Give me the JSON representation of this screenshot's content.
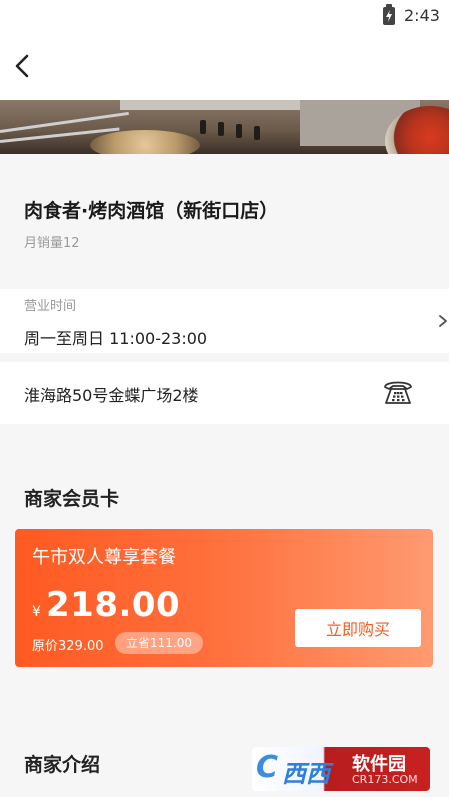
{
  "status_bar": {
    "time": "2:43"
  },
  "shop": {
    "name": "肉食者·烤肉酒馆（新街口店）",
    "monthly_sales": "月销量12"
  },
  "hours": {
    "label": "营业时间",
    "value": "周一至周日 11:00-23:00"
  },
  "address": {
    "text": "淮海路50号金蝶广场2楼"
  },
  "membership": {
    "section_title": "商家会员卡",
    "package_name": "午市双人尊享套餐",
    "currency": "¥",
    "price": "218.00",
    "original_price": "原价329.00",
    "save_badge": "立省111.00",
    "buy_label": "立即购买"
  },
  "intro": {
    "section_title": "商家介绍"
  },
  "watermark": {
    "main": "软件园",
    "sub": "CR173.COM",
    "logo": "西西"
  },
  "colors": {
    "accent": "#ff5a22",
    "card_gradient_end": "#ff9a70",
    "muted_text": "#999999"
  },
  "icons": [
    "battery-charging-icon",
    "back-arrow-icon",
    "chevron-right-icon",
    "telephone-icon"
  ]
}
